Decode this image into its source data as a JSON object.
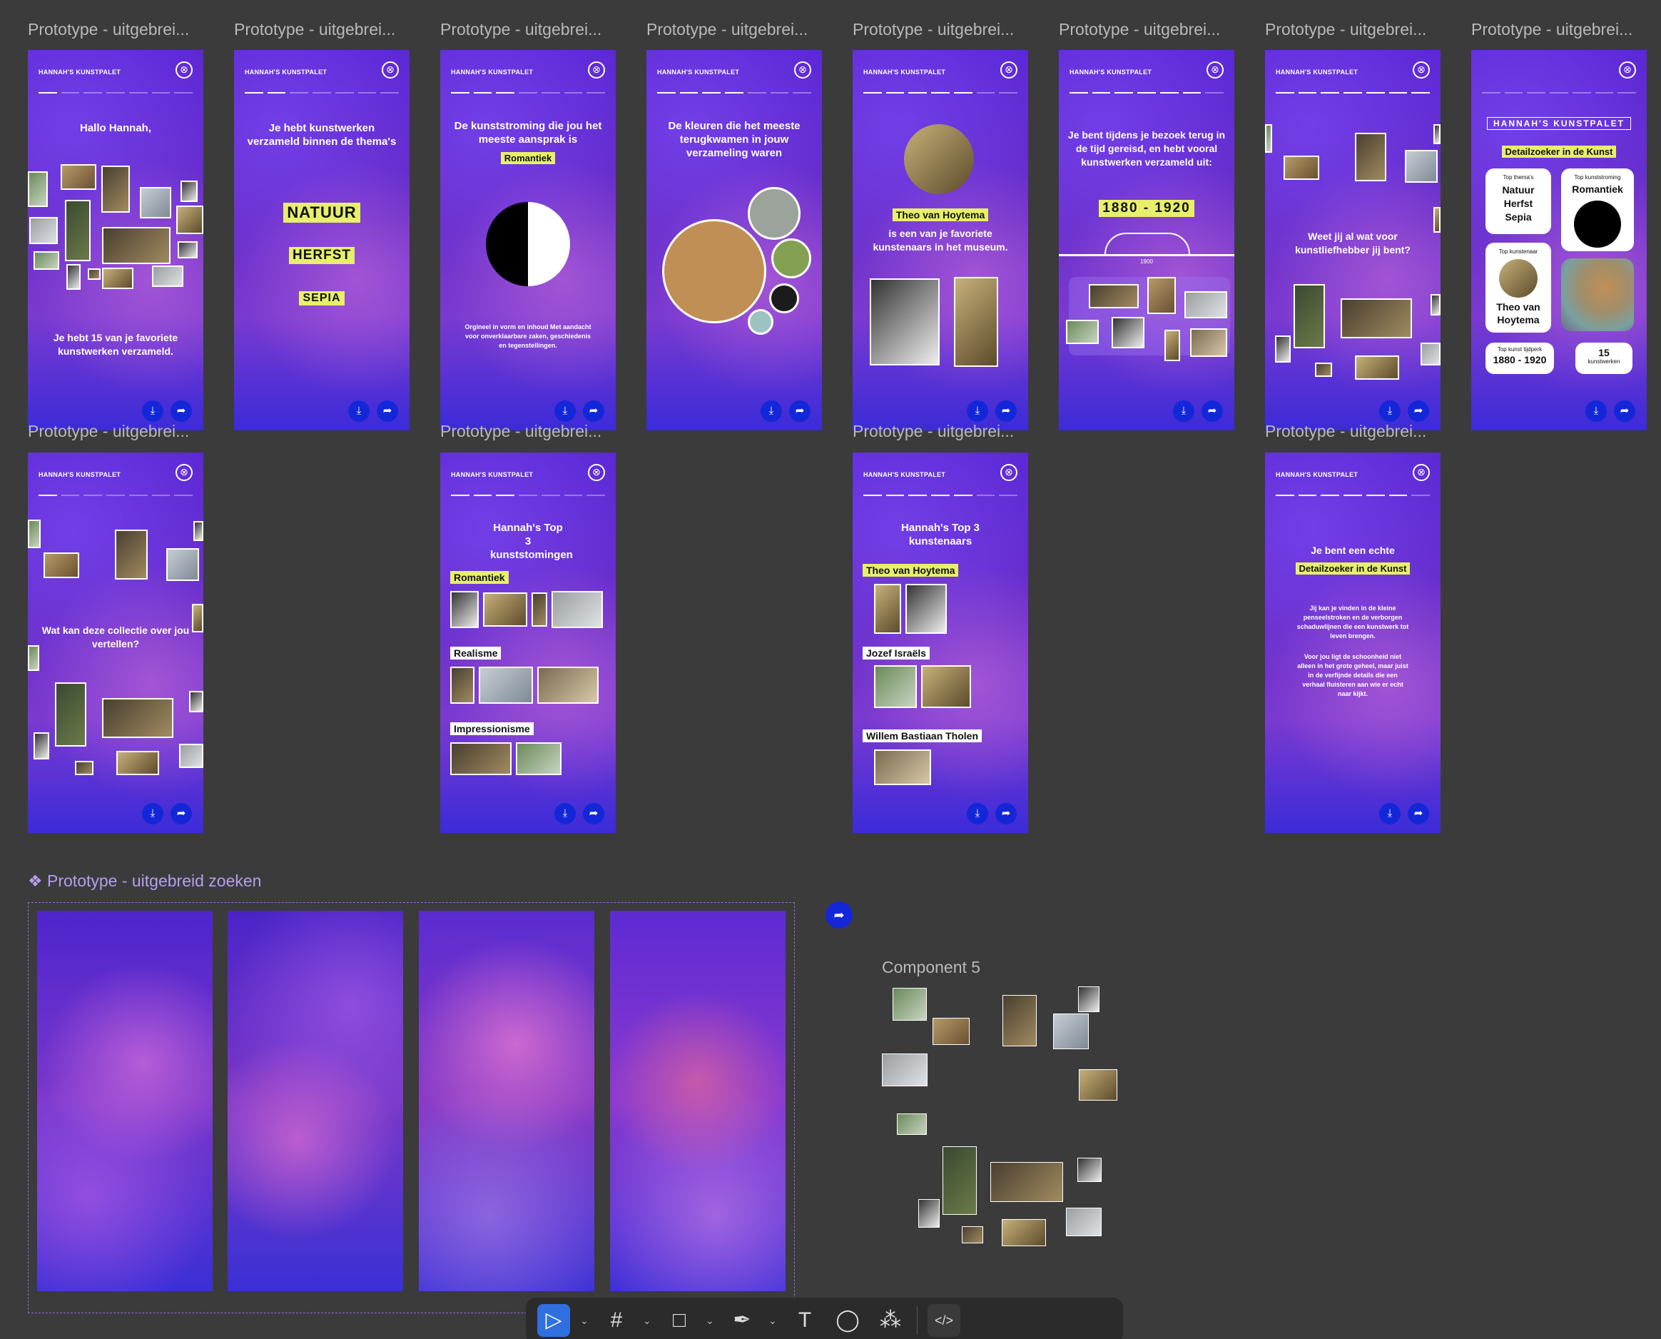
{
  "frame_titles": {
    "f1": "Prototype - uitgebrei...",
    "f2": "Prototype - uitgebrei...",
    "f3": "Prototype - uitgebrei...",
    "f4": "Prototype - uitgebrei...",
    "f5": "Prototype - uitgebrei...",
    "f6": "Prototype - uitgebrei...",
    "f7": "Prototype - uitgebrei...",
    "f8": "Prototype - uitgebrei...",
    "f9": "Prototype - uitgebrei...",
    "f10": "Prototype - uitgebrei...",
    "f11": "Prototype - uitgebrei...",
    "f12": "Prototype - uitgebrei..."
  },
  "brand": "HANNAH'S KUNSTPALET",
  "close_glyph": "⊗",
  "download_glyph": "⤓",
  "share_glyph": "➦",
  "screens": {
    "s1": {
      "heading": "Hallo Hannah,",
      "footer": "Je hebt 15 van je favoriete kunstwerken verzameld."
    },
    "s2": {
      "heading": "Je hebt kunstwerken verzameld binnen de thema's",
      "themes": [
        "NATUUR",
        "HERFST",
        "SEPIA"
      ]
    },
    "s3": {
      "heading": "De kunststroming die jou het meeste aansprak is",
      "highlight": "Romantiek",
      "body": "Orgineel in vorm en inhoud Met aandacht voor onverklaarbare zaken, geschiedenis en tegenstellingen."
    },
    "s4": {
      "heading": "De kleuren die het meeste terugkwamen in jouw verzameling waren"
    },
    "s5": {
      "highlight": "Theo van Hoytema",
      "body": "is een van je favoriete kunstenaars in het museum."
    },
    "s6": {
      "heading": "Je bent tijdens je bezoek terug in de tijd gereisd, en hebt vooral kunstwerken verzameld uit:",
      "range": "1880 - 1920",
      "tick": "1900"
    },
    "s7": {
      "heading": "Weet jij al wat voor kunstliefhebber jij bent?"
    },
    "s8": {
      "wordmark": "HANNAH'S KUNSTPALET",
      "highlight": "Detailzoeker in de Kunst",
      "card_themes_label": "Top thema's",
      "card_themes_value": "Natuur Herfst Sepia",
      "card_movement_label": "Top kunststroming",
      "card_movement_value": "Romantiek",
      "card_artist_label": "Top kunstenaar",
      "card_artist_value": "Theo van Hoytema",
      "card_era_label": "Top kunst tijdperk",
      "card_era_value": "1880 - 1920",
      "card_count_value": "15",
      "card_count_label": "kunstwerken"
    },
    "s9": {
      "heading": "Wat kan deze collectie over jou vertellen?"
    },
    "s10": {
      "heading": "Hannah's Top 3 kunststomingen",
      "labels": [
        "Romantiek",
        "Realisme",
        "Impressionisme"
      ]
    },
    "s11": {
      "heading": "Hannah's Top 3 kunstenaars",
      "labels": [
        "Theo van Hoytema",
        "Jozef Israëls",
        "Willem Bastiaan Tholen"
      ]
    },
    "s12": {
      "heading": "Je bent een echte",
      "highlight": "Detailzoeker in de Kunst",
      "para1": "Jij kan je vinden in de kleine penseelstroken en de verborgen schaduwlijnen die een kunstwerk tot leven brengen.",
      "para2": "Voor jou ligt de schoonheid niet alleen in het grote geheel, maar juist in de verfijnde details die een verhaal fluisteren aan wie er echt naar kijkt."
    }
  },
  "component_set_title": "❖ Prototype - uitgebreid zoeken",
  "component5_title": "Component 5",
  "colors": {
    "canvas": "#3b3b3b",
    "accent_yellow": "#e7ef6b",
    "action_blue": "#1327d8",
    "swatches": [
      "#c08f56",
      "#9ca39a",
      "#84a052",
      "#1b1b1b",
      "#9cc3c2"
    ]
  },
  "toolbar": {
    "move": "▷",
    "frame": "#",
    "shape": "□",
    "pen": "✒",
    "text": "T",
    "comment": "◯",
    "resources": "⁂",
    "dev": "</>",
    "chevron": "⌄"
  }
}
